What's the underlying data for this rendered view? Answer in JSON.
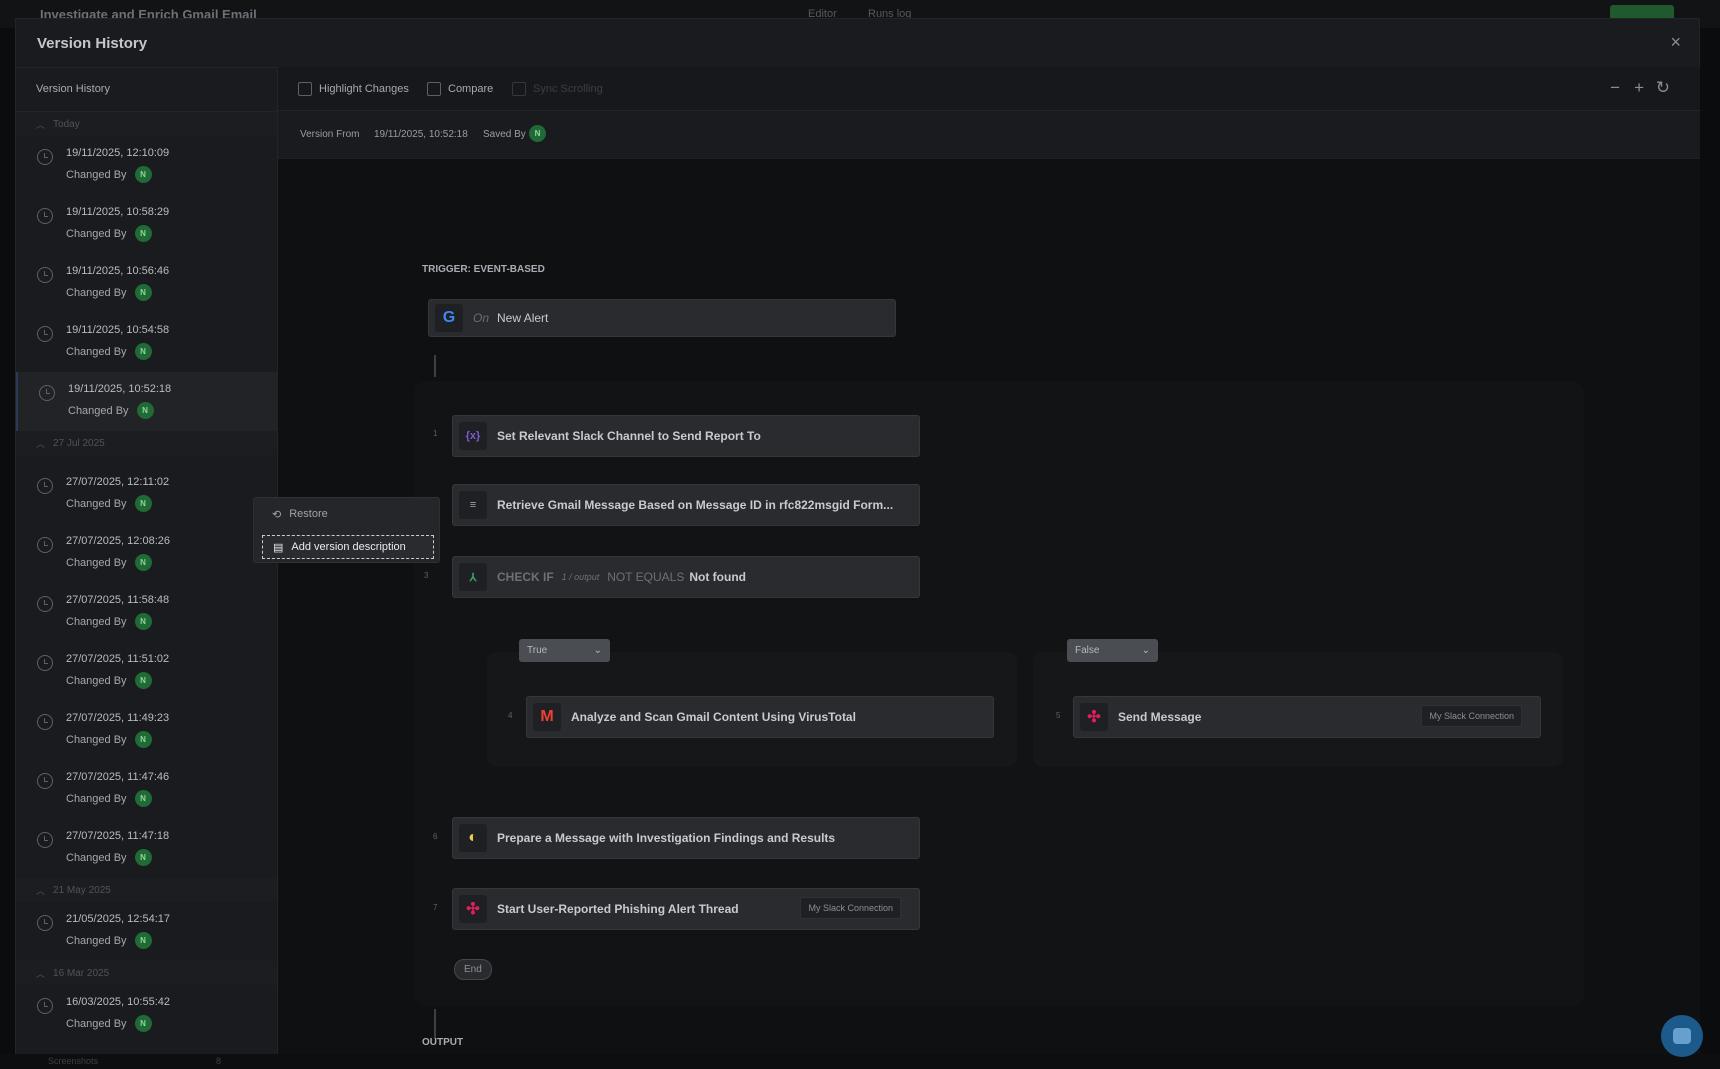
{
  "app": {
    "title": "Investigate and Enrich Gmail Email",
    "tabs": [
      "Editor",
      "Runs log"
    ]
  },
  "modal": {
    "title": "Version History",
    "close_icon": "×"
  },
  "sidebar": {
    "header": "Version History",
    "groups": [
      {
        "label": "Today",
        "items": [
          {
            "ts": "19/11/2025, 12:10:09",
            "changed_by": "Changed By",
            "avatar": "N"
          },
          {
            "ts": "19/11/2025, 10:58:29",
            "changed_by": "Changed By",
            "avatar": "N"
          },
          {
            "ts": "19/11/2025, 10:56:46",
            "changed_by": "Changed By",
            "avatar": "N"
          },
          {
            "ts": "19/11/2025, 10:54:58",
            "changed_by": "Changed By",
            "avatar": "N"
          },
          {
            "ts": "19/11/2025, 10:52:18",
            "changed_by": "Changed By",
            "avatar": "N"
          }
        ]
      },
      {
        "label": "27 Jul 2025",
        "items": [
          {
            "ts": "27/07/2025, 12:11:02",
            "changed_by": "Changed By",
            "avatar": "N"
          },
          {
            "ts": "27/07/2025, 12:08:26",
            "changed_by": "Changed By",
            "avatar": "N"
          },
          {
            "ts": "27/07/2025, 11:58:48",
            "changed_by": "Changed By",
            "avatar": "N"
          },
          {
            "ts": "27/07/2025, 11:51:02",
            "changed_by": "Changed By",
            "avatar": "N"
          },
          {
            "ts": "27/07/2025, 11:49:23",
            "changed_by": "Changed By",
            "avatar": "N"
          },
          {
            "ts": "27/07/2025, 11:47:46",
            "changed_by": "Changed By",
            "avatar": "N"
          },
          {
            "ts": "27/07/2025, 11:47:18",
            "changed_by": "Changed By",
            "avatar": "N"
          }
        ]
      },
      {
        "label": "21 May 2025",
        "items": [
          {
            "ts": "21/05/2025, 12:54:17",
            "changed_by": "Changed By",
            "avatar": "N"
          }
        ]
      },
      {
        "label": "16 Mar 2025",
        "items": [
          {
            "ts": "16/03/2025, 10:55:42",
            "changed_by": "Changed By",
            "avatar": "N"
          }
        ]
      }
    ]
  },
  "toolbar": {
    "highlight_changes": "Highlight Changes",
    "compare": "Compare",
    "sync_scrolling": "Sync Scrolling",
    "zoom_out": "−",
    "zoom_in": "+",
    "reset": "↻"
  },
  "info": {
    "version_from_label": "Version From",
    "version_from_value": "19/11/2025, 10:52:18",
    "saved_by_label": "Saved By",
    "saved_by_avatar": "N"
  },
  "context_menu": {
    "restore": "Restore",
    "add_description": "Add version description"
  },
  "flow": {
    "trigger_label": "TRIGGER: EVENT-BASED",
    "trigger_prefix": "On",
    "trigger_name": "New Alert",
    "steps": [
      {
        "num": "1",
        "label": "Set Relevant Slack Channel to Send Report To",
        "icon": "{x}"
      },
      {
        "num": "",
        "label": "Retrieve Gmail Message Based on Message ID in rfc822msgid Form...",
        "icon": "≡"
      },
      {
        "num": "3",
        "check_if": "CHECK IF",
        "operand": "1 / output",
        "operator": "NOT EQUALS",
        "value": "Not found"
      },
      {
        "num": "4",
        "label": "Analyze and Scan Gmail Content Using VirusTotal"
      },
      {
        "num": "5",
        "label": "Send Message",
        "connection": "My Slack Connection"
      },
      {
        "num": "6",
        "label": "Prepare a Message with Investigation Findings and Results"
      },
      {
        "num": "7",
        "label": "Start User-Reported Phishing Alert Thread",
        "connection": "My Slack Connection"
      }
    ],
    "true_label": "True",
    "false_label": "False",
    "end_label": "End",
    "output_label": "OUTPUT"
  },
  "bottom": {
    "label": "Screenshots",
    "count": "8"
  },
  "colors": {
    "accent_green": "#1f6a35",
    "chat_fab": "#1d5a8c"
  }
}
